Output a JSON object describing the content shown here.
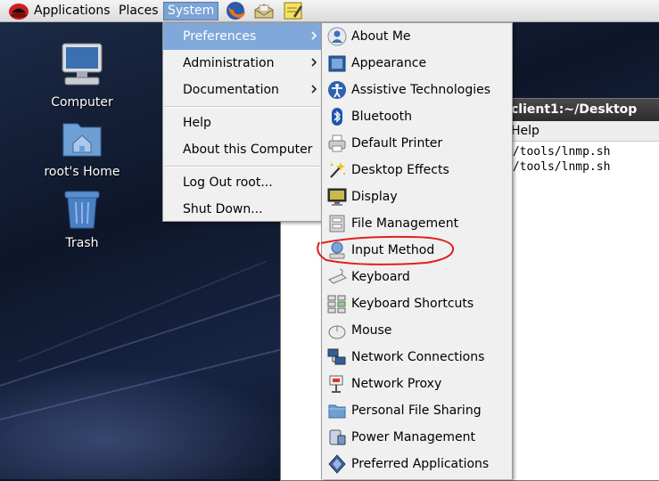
{
  "top_panel": {
    "applications": "Applications",
    "places": "Places",
    "system": "System",
    "launchers": [
      "firefox-icon",
      "mail-icon",
      "notes-icon"
    ]
  },
  "desktop": {
    "icons": [
      {
        "label": "Computer",
        "icon": "computer-icon"
      },
      {
        "label": "root's Home",
        "icon": "home-folder-icon"
      },
      {
        "label": "Trash",
        "icon": "trash-icon"
      }
    ]
  },
  "terminal": {
    "title": "client1:~/Desktop",
    "menu_help": "Help",
    "lines": [
      "e/tools/lnmp.sh",
      "e/tools/lnmp.sh"
    ]
  },
  "system_menu": {
    "items": [
      {
        "label": "Preferences",
        "submenu": true,
        "active": true
      },
      {
        "label": "Administration",
        "submenu": true
      },
      {
        "label": "Documentation",
        "submenu": true
      },
      {
        "label": "Help"
      },
      {
        "label": "About this Computer"
      },
      {
        "label": "Log Out root..."
      },
      {
        "label": "Shut Down..."
      }
    ]
  },
  "preferences_menu": {
    "items": [
      {
        "label": "About Me",
        "icon": "about-me-icon"
      },
      {
        "label": "Appearance",
        "icon": "appearance-icon"
      },
      {
        "label": "Assistive Technologies",
        "icon": "accessibility-icon"
      },
      {
        "label": "Bluetooth",
        "icon": "bluetooth-icon"
      },
      {
        "label": "Default Printer",
        "icon": "printer-icon"
      },
      {
        "label": "Desktop Effects",
        "icon": "desktop-effects-icon"
      },
      {
        "label": "Display",
        "icon": "display-icon"
      },
      {
        "label": "File Management",
        "icon": "file-management-icon"
      },
      {
        "label": "Input Method",
        "icon": "input-method-icon",
        "highlighted": true
      },
      {
        "label": "Keyboard",
        "icon": "keyboard-icon"
      },
      {
        "label": "Keyboard Shortcuts",
        "icon": "keyboard-shortcuts-icon"
      },
      {
        "label": "Mouse",
        "icon": "mouse-icon"
      },
      {
        "label": "Network Connections",
        "icon": "network-connections-icon"
      },
      {
        "label": "Network Proxy",
        "icon": "network-proxy-icon"
      },
      {
        "label": "Personal File Sharing",
        "icon": "file-sharing-icon"
      },
      {
        "label": "Power Management",
        "icon": "power-management-icon"
      },
      {
        "label": "Preferred Applications",
        "icon": "preferred-applications-icon"
      }
    ]
  },
  "colors": {
    "menu_highlight": "#80a8da",
    "annotation": "#e0201a"
  }
}
